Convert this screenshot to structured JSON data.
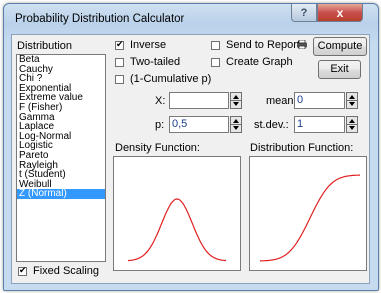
{
  "window": {
    "title": "Probability Distribution Calculator",
    "help_label": "?",
    "close_label": "x"
  },
  "distribution": {
    "label": "Distribution",
    "items": [
      "Beta",
      "Cauchy",
      "Chi ?",
      "Exponential",
      "Extreme value",
      "F (Fisher)",
      "Gamma",
      "Laplace",
      "Log-Normal",
      "Logistic",
      "Pareto",
      "Rayleigh",
      "t (Student)",
      "Weibull",
      "Z (Normal)"
    ],
    "selected": "Z (Normal)"
  },
  "options": {
    "inverse": {
      "label": "Inverse",
      "checked": true
    },
    "two_tailed": {
      "label": "Two-tailed",
      "checked": false
    },
    "one_minus_cumulative": {
      "label": "(1-Cumulative p)",
      "checked": false
    },
    "send_to_report": {
      "label": "Send to Report",
      "checked": false
    },
    "create_graph": {
      "label": "Create Graph",
      "checked": false
    },
    "fixed_scaling": {
      "label": "Fixed Scaling",
      "checked": true
    }
  },
  "buttons": {
    "compute": "Compute",
    "exit": "Exit"
  },
  "fields": {
    "x": {
      "label": "X:",
      "value": ""
    },
    "p": {
      "label": "p:",
      "value": "0,5"
    },
    "mean": {
      "label": "mean:",
      "value": "0"
    },
    "stdev": {
      "label": "st.dev.:",
      "value": "1"
    }
  },
  "plots": {
    "density_label": "Density Function:",
    "distribution_label": "Distribution Function:",
    "curve_color": "#e02020"
  },
  "icons": {
    "report": "printer-icon"
  }
}
